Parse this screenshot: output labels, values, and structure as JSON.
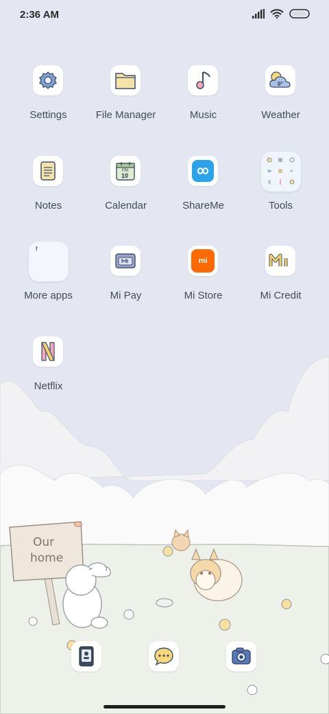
{
  "status": {
    "time": "2:36 AM"
  },
  "apps": [
    {
      "label": "Settings"
    },
    {
      "label": "File Manager"
    },
    {
      "label": "Music"
    },
    {
      "label": "Weather",
      "badge": "0°"
    },
    {
      "label": "Notes"
    },
    {
      "label": "Calendar",
      "day": "FRI",
      "date": "10"
    },
    {
      "label": "ShareMe"
    },
    {
      "label": "Tools"
    },
    {
      "label": "More apps",
      "folder_badge": "f"
    },
    {
      "label": "Mi Pay"
    },
    {
      "label": "Mi Store",
      "logo": "mi"
    },
    {
      "label": "Mi Credit"
    },
    {
      "label": "Netflix"
    }
  ],
  "wallpaper": {
    "sign_text_1": "Our",
    "sign_text_2": "home"
  },
  "colors": {
    "sky": "#e4e7f1",
    "accent_blue": "#2ba3e8",
    "mi_orange": "#ff6a00",
    "label_text": "#454a55"
  }
}
